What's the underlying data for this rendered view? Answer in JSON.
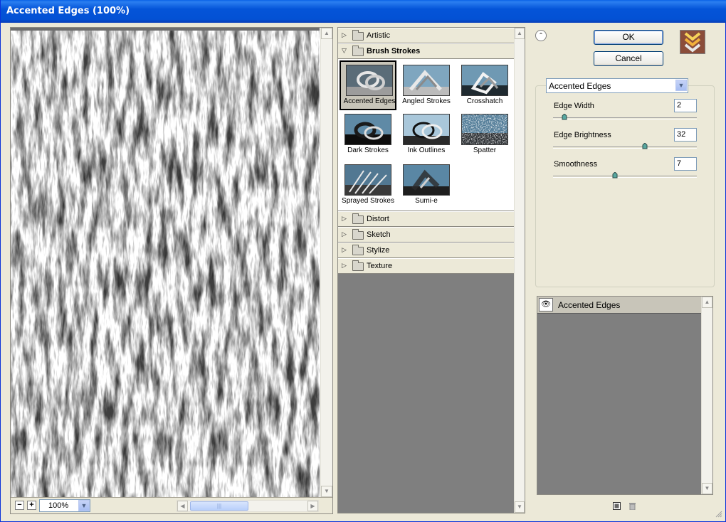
{
  "window": {
    "title": "Accented Edges (100%)"
  },
  "preview": {
    "zoom": "100%",
    "zoom_out_label": "−",
    "zoom_in_label": "+"
  },
  "categories": [
    {
      "label": "Artistic",
      "expanded": false
    },
    {
      "label": "Brush Strokes",
      "expanded": true
    },
    {
      "label": "Distort",
      "expanded": false
    },
    {
      "label": "Sketch",
      "expanded": false
    },
    {
      "label": "Stylize",
      "expanded": false
    },
    {
      "label": "Texture",
      "expanded": false
    }
  ],
  "brush_strokes": [
    {
      "label": "Accented Edges",
      "selected": true
    },
    {
      "label": "Angled Strokes",
      "selected": false
    },
    {
      "label": "Crosshatch",
      "selected": false
    },
    {
      "label": "Dark Strokes",
      "selected": false
    },
    {
      "label": "Ink Outlines",
      "selected": false
    },
    {
      "label": "Spatter",
      "selected": false
    },
    {
      "label": "Sprayed Strokes",
      "selected": false
    },
    {
      "label": "Sumi-e",
      "selected": false
    }
  ],
  "buttons": {
    "ok": "OK",
    "cancel": "Cancel"
  },
  "settings": {
    "filter": "Accented Edges",
    "params": [
      {
        "label": "Edge Width",
        "value": "2",
        "min": 1,
        "max": 14
      },
      {
        "label": "Edge Brightness",
        "value": "32",
        "min": 0,
        "max": 50
      },
      {
        "label": "Smoothness",
        "value": "7",
        "min": 1,
        "max": 15
      }
    ]
  },
  "layers": [
    {
      "label": "Accented Edges"
    }
  ],
  "colors": {
    "title_bar": "#0454d8",
    "panel": "#ece9d8",
    "gallery_bg": "#7f7f7f"
  }
}
